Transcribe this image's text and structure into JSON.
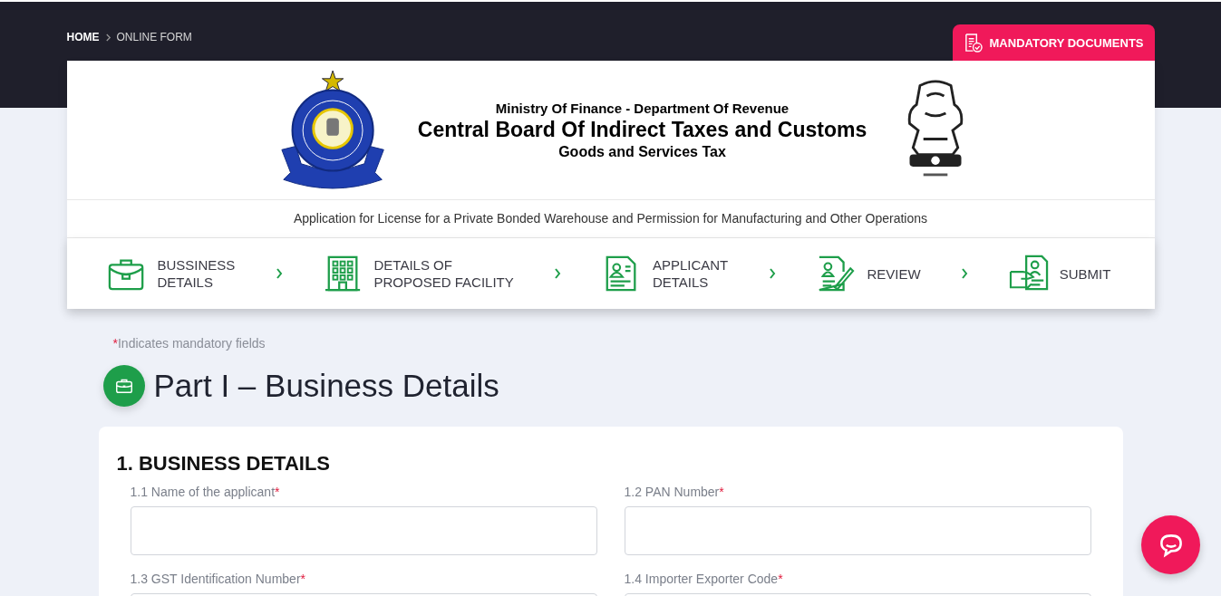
{
  "breadcrumb": [
    "HOME",
    "ONLINE FORM"
  ],
  "documents_button": {
    "label": "MANDATORY DOCUMENTS"
  },
  "header": {
    "ministry": "Ministry Of Finance - Department Of Revenue",
    "board": "Central Board Of Indirect Taxes and Customs",
    "department": "Goods and Services Tax"
  },
  "application_title": "Application for License for a Private Bonded Warehouse and Permission for Manufacturing and Other Operations",
  "steps": [
    {
      "label": [
        "BUSSINESS",
        "DETAILS"
      ]
    },
    {
      "label": [
        "DETAILS OF",
        "PROPOSED FACILITY"
      ]
    },
    {
      "label": [
        "APPLICANT",
        "DETAILS"
      ]
    },
    {
      "label": [
        "REVIEW"
      ]
    },
    {
      "label": [
        "SUBMIT"
      ]
    }
  ],
  "mandatory_note": {
    "mark": "*",
    "text": "Indicates mandatory fields"
  },
  "part_title": "Part I – Business Details",
  "section": {
    "title": "1. BUSINESS DETAILS",
    "fields": [
      {
        "label": "1.1 Name of the applicant",
        "mark": "*"
      },
      {
        "label": "1.2 PAN Number",
        "mark": "*"
      },
      {
        "label": "1.3 GST Identification Number",
        "mark": "*"
      },
      {
        "label": "1.4 Importer Exporter Code",
        "mark": "*"
      }
    ]
  }
}
